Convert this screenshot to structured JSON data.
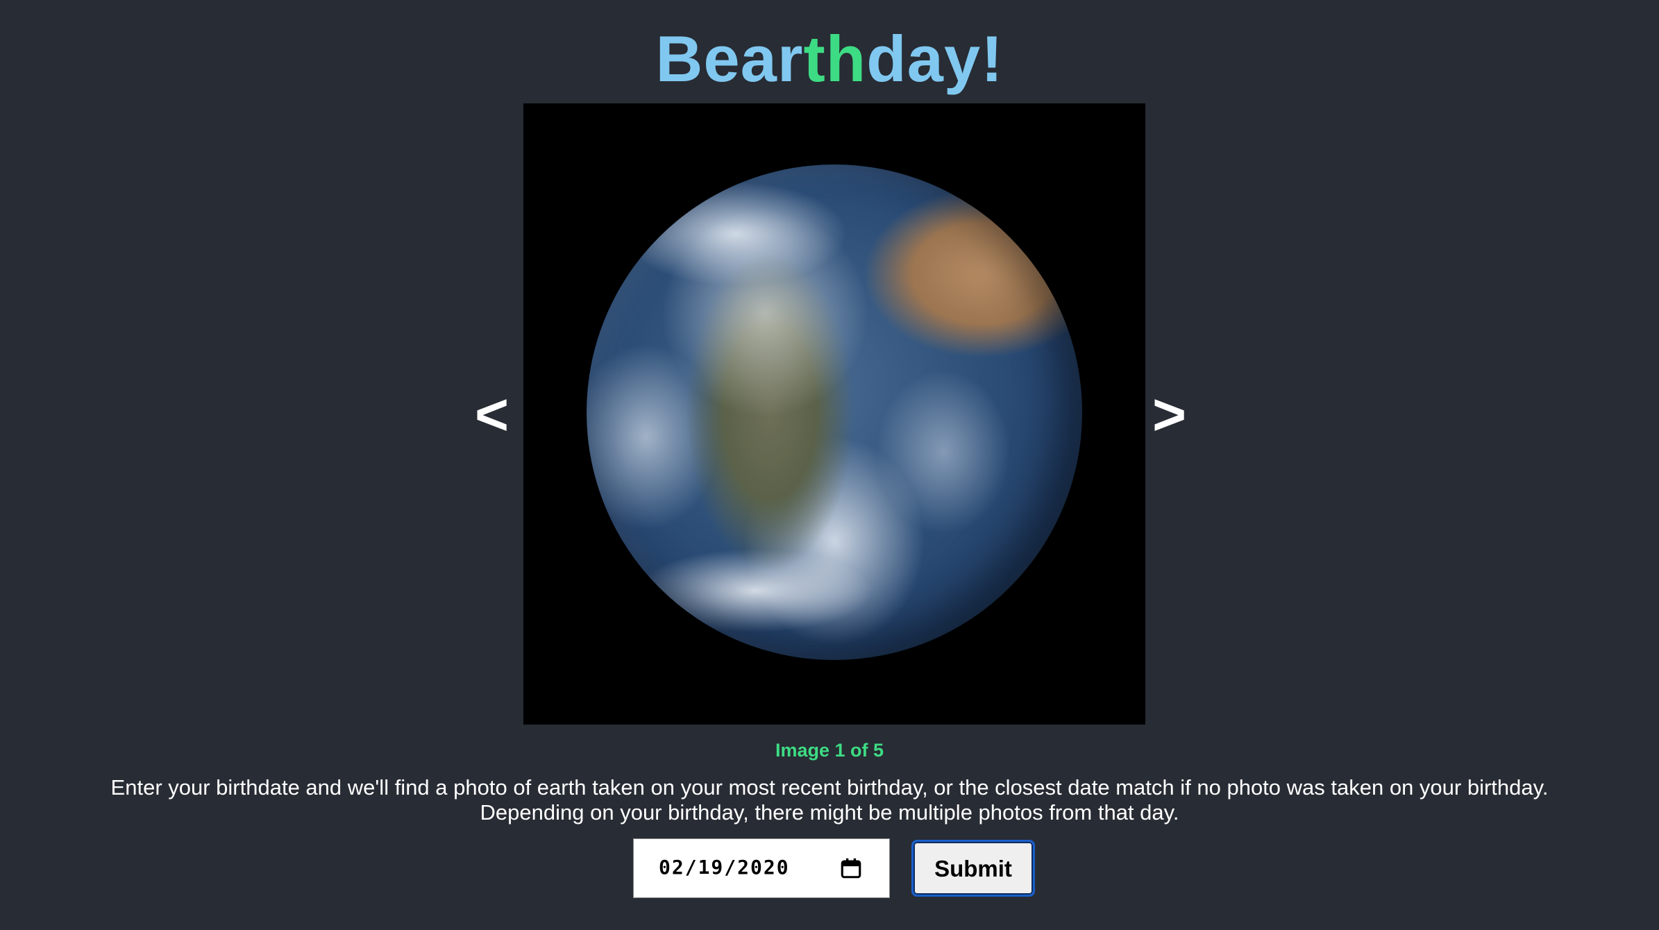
{
  "header": {
    "title_part1": "Bear",
    "title_part2": "th",
    "title_part3": "day!"
  },
  "viewer": {
    "prev_label": "<",
    "next_label": ">",
    "counter": "Image 1 of 5"
  },
  "description": {
    "line1": "Enter your birthdate and we'll find a photo of earth taken on your most recent birthday, or the closest date match if no photo was taken on your birthday.",
    "line2": "Depending on your birthday, there might be multiple photos from that day."
  },
  "form": {
    "date_value": "02/19/2020",
    "submit_label": "Submit"
  },
  "colors": {
    "background": "#282c34",
    "title_blue": "#80c8f0",
    "title_green": "#3ddc84",
    "counter_green": "#3ddc84"
  }
}
